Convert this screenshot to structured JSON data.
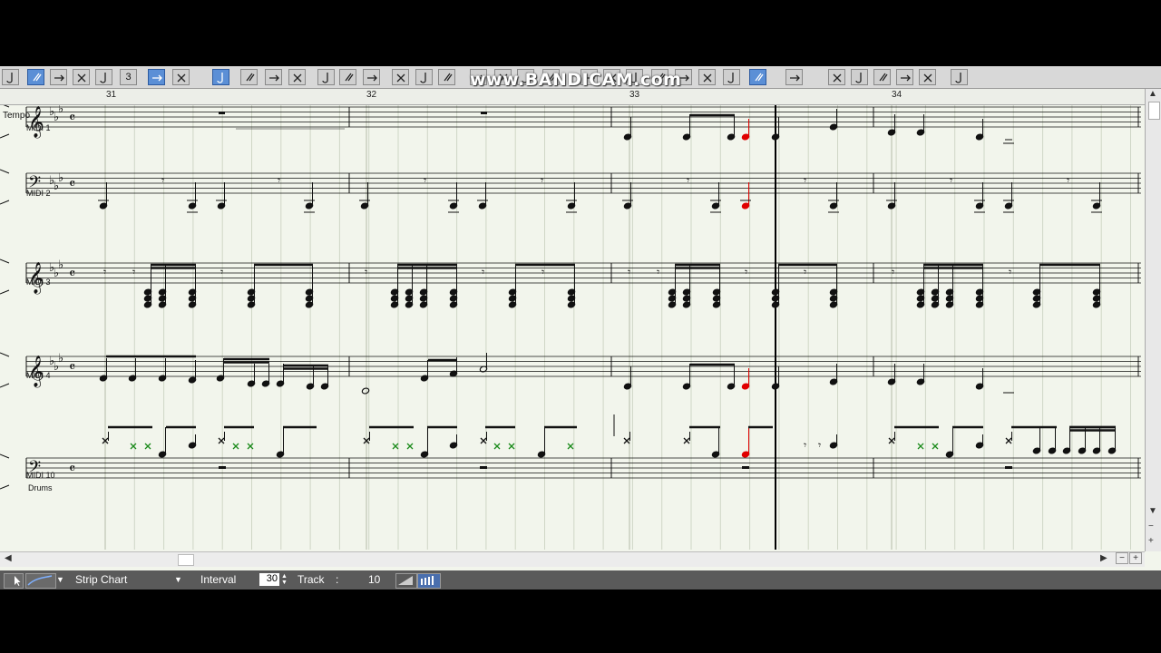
{
  "watermark": "www.BANDICAM.com",
  "toolbar": {
    "buttons": [
      "select-tool",
      "whole-note",
      "half-note",
      "quarter-note",
      "eighth-note",
      "sixteenth-note",
      "triplet",
      "tie",
      "rest",
      "grace-note",
      "beam",
      "beam-break",
      "beam-join",
      "stem-up",
      "stem-down",
      "slur",
      "text-tool",
      "insert-bar",
      "delete-bar",
      "undo",
      "redo",
      "transpose",
      "quantize",
      "zoom",
      "split",
      "eraser",
      "snap"
    ],
    "triplet_label": "3"
  },
  "ruler": {
    "measures": [
      "31",
      "32",
      "33",
      "34"
    ]
  },
  "tempo_label": "Tempo",
  "tracks": [
    {
      "name": "MIDI 1",
      "clef": "treble"
    },
    {
      "name": "MIDI 2",
      "clef": "bass"
    },
    {
      "name": "MIDI 3",
      "clef": "treble"
    },
    {
      "name": "MIDI 4",
      "clef": "treble"
    },
    {
      "name": "MIDI 10",
      "clef": "bass",
      "sub": "Drums"
    }
  ],
  "time_signature": "c",
  "status": {
    "mode": "Strip Chart",
    "interval_label": "Interval",
    "interval_value": "30",
    "track_label": "Track",
    "track_sep": ":",
    "track_value": "10"
  },
  "colors": {
    "selected_note": "#e00000",
    "drum_x": "#1a8a1a",
    "toolbar_active": "#5b8fd6"
  }
}
